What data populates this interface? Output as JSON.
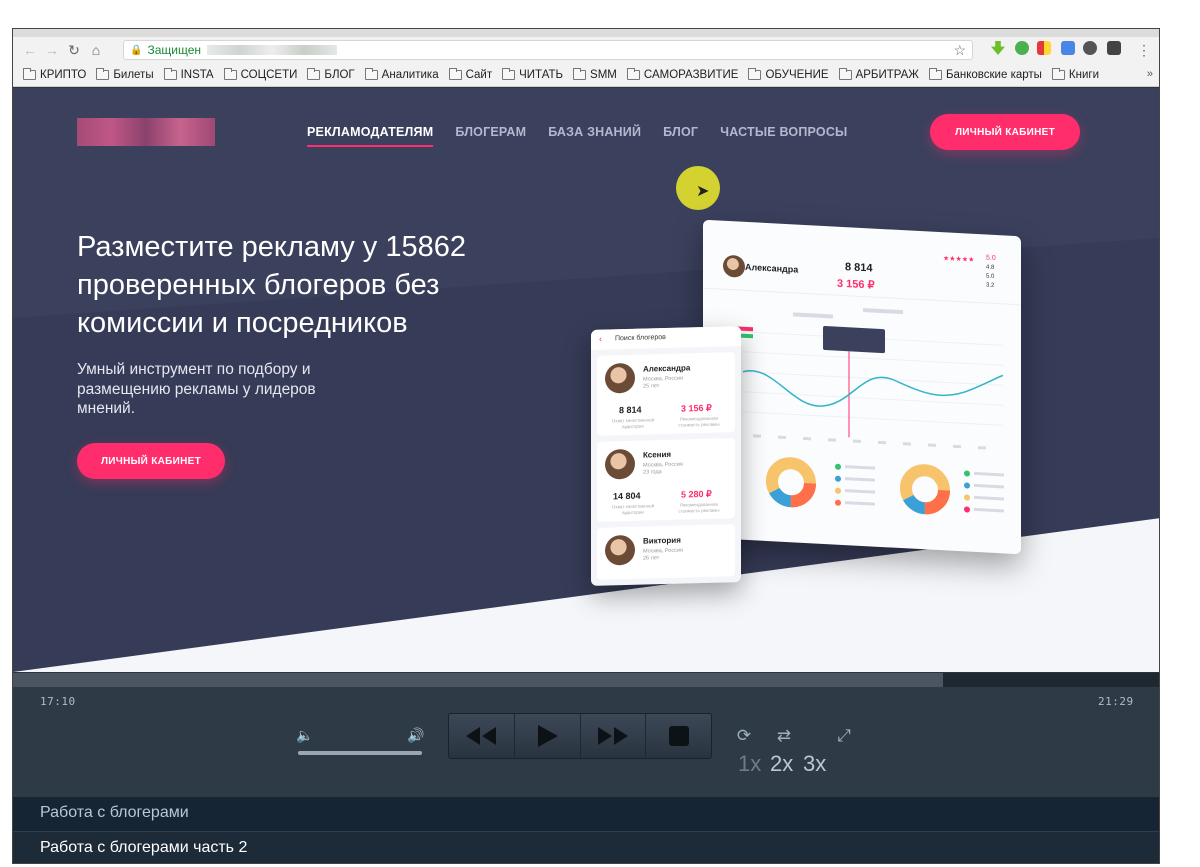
{
  "browser": {
    "secure_label": "Защищен",
    "bookmarks": [
      "КРИПТО",
      "Билеты",
      "INSTA",
      "СОЦСЕТИ",
      "БЛОГ",
      "Аналитика",
      "Сайт",
      "ЧИТАТЬ",
      "SMM",
      "САМОРАЗВИТИЕ",
      "ОБУЧЕНИЕ",
      "АРБИТРАЖ",
      "Банковские карты",
      "Книги"
    ],
    "more": "»"
  },
  "site": {
    "nav": [
      "РЕКЛАМОДАТЕЛЯМ",
      "БЛОГЕРАМ",
      "БАЗА ЗНАНИЙ",
      "БЛОГ",
      "ЧАСТЫЕ ВОПРОСЫ"
    ],
    "cabinet_top": "ЛИЧНЫЙ КАБИНЕТ",
    "hero_title": "Разместите рекламу у 15862 проверенных блогеров без комиссии и посредников",
    "hero_sub": "Умный инструмент по подбору и размещению рекламы у лидеров мнений.",
    "cabinet_hero": "ЛИЧНЫЙ КАБИНЕТ",
    "dashboard": {
      "name": "Александра",
      "audience": "8 814",
      "price": "3 156 ₽",
      "stars": "★★★★★",
      "rating_main": "5.0",
      "rating_2": "4.8",
      "rating_3": "5.0",
      "rating_4": "3.2"
    },
    "search": {
      "title": "Поиск блогеров",
      "cards": [
        {
          "name": "Александра",
          "city": "Москва, Россия",
          "age": "25 лет",
          "audience": "8 814",
          "price": "3 156 ₽",
          "cap1": "Охват качественной аудитории",
          "cap2": "Рекомендованная стоимость рекламы"
        },
        {
          "name": "Ксения",
          "city": "Москва, Россия",
          "age": "23 года",
          "audience": "14 804",
          "price": "5 280 ₽",
          "cap1": "Охват качественной аудитории",
          "cap2": "Рекомендованная стоимость рекламы"
        },
        {
          "name": "Виктория",
          "city": "Москва, Россия",
          "age": "26 лет"
        }
      ]
    }
  },
  "player": {
    "time_current": "17:10",
    "time_total": "21:29",
    "progress": 0.81,
    "volume": 1.0,
    "speeds": [
      "1x",
      "2x",
      "3x"
    ],
    "playlist": [
      {
        "title": "Работа с блогерами",
        "active": false
      },
      {
        "title": "Работа с блогерами часть 2",
        "active": true
      }
    ]
  }
}
